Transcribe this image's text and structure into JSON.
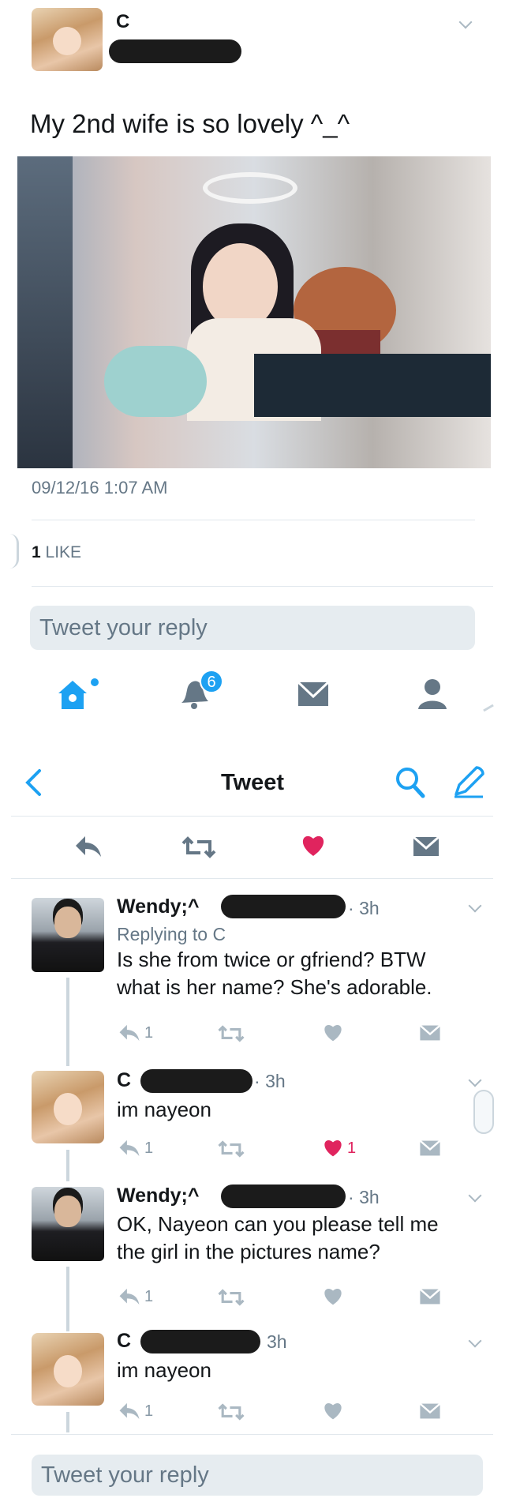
{
  "original_tweet": {
    "author": "C",
    "text": "My 2nd wife is so lovely ^_^",
    "timestamp": "09/12/16 1:07 AM",
    "likes_count": "1",
    "likes_label": "LIKE"
  },
  "reply_box_top": {
    "placeholder": "Tweet your reply"
  },
  "tab_bar": {
    "notifications_badge": "6"
  },
  "header": {
    "title": "Tweet"
  },
  "replies": [
    {
      "author": "Wendy;^",
      "time": "3h",
      "replying_to": "Replying to C",
      "text_line1": "Is she from twice or gfriend? BTW",
      "text_line2": "what is her name? She's adorable.",
      "reply_count": "1",
      "like_count": ""
    },
    {
      "author": "C",
      "time": "3h",
      "text_line1": "im nayeon",
      "reply_count": "1",
      "like_count": "1"
    },
    {
      "author": "Wendy;^",
      "time": "3h",
      "text_line1": "OK, Nayeon can you please tell me",
      "text_line2": "the girl in the pictures name?",
      "reply_count": "1"
    },
    {
      "author": "C",
      "time": "3h",
      "text_line1": "im nayeon",
      "reply_count": "1"
    }
  ],
  "reply_box_bottom": {
    "placeholder": "Tweet your reply"
  },
  "colors": {
    "accent": "#1da1f2",
    "like": "#e0245e",
    "icon_gray": "#aab8c2",
    "icon_dark": "#657786"
  }
}
